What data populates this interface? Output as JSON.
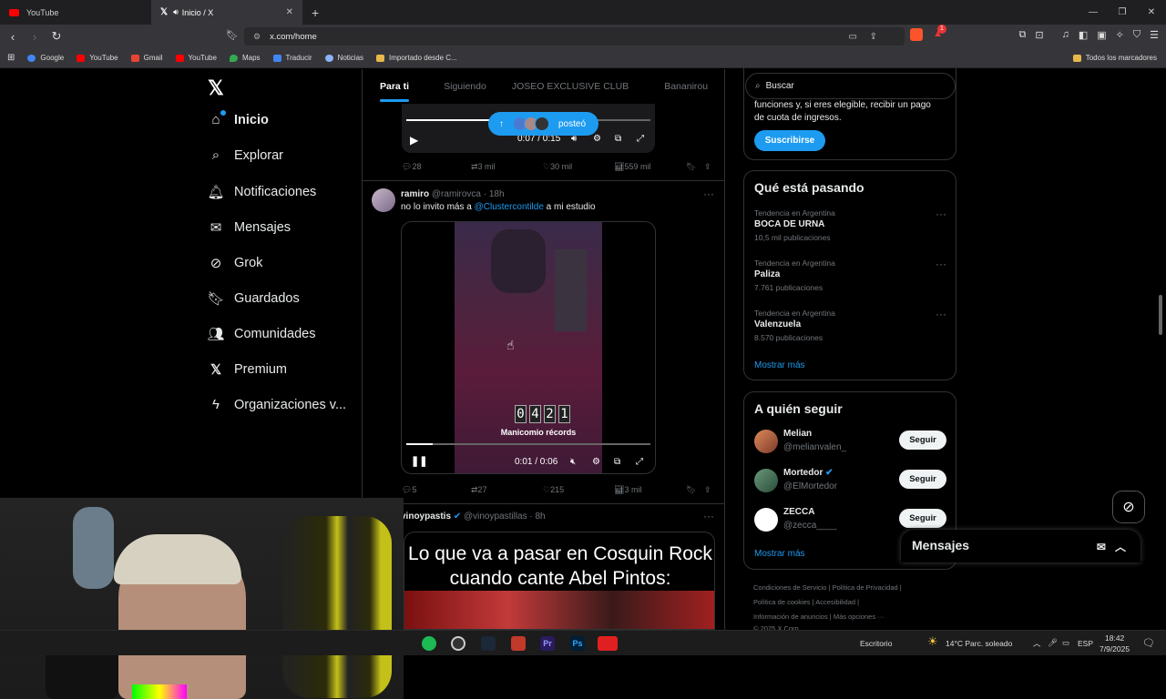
{
  "browser": {
    "tabs": [
      {
        "label": "YouTube",
        "active": false
      },
      {
        "label": "Inicio / X",
        "active": true
      }
    ],
    "new_tab": "+",
    "url": "x.com/home",
    "brave_badge": "1",
    "bookmarks": [
      "Google",
      "YouTube",
      "Gmail",
      "YouTube",
      "Maps",
      "Traducir",
      "Noticias",
      "Importado desde C..."
    ],
    "all_bookmarks": "Todos los marcadores"
  },
  "left_nav": {
    "items": [
      {
        "label": "Inicio",
        "icon": "home-icon"
      },
      {
        "label": "Explorar",
        "icon": "search-icon"
      },
      {
        "label": "Notificaciones",
        "icon": "bell-icon"
      },
      {
        "label": "Mensajes",
        "icon": "envelope-icon"
      },
      {
        "label": "Grok",
        "icon": "grok-icon"
      },
      {
        "label": "Guardados",
        "icon": "bookmark-icon"
      },
      {
        "label": "Comunidades",
        "icon": "people-icon"
      },
      {
        "label": "Premium",
        "icon": "x-icon"
      },
      {
        "label": "Organizaciones v...",
        "icon": "lightning-icon"
      }
    ]
  },
  "feed": {
    "tabs": [
      "Para ti",
      "Siguiendo",
      "JOSEO EXCLUSIVE CLUB",
      "Bananirou"
    ],
    "posteo_label": "posteó",
    "post1": {
      "time": "0:07 / 0:15",
      "progress": 0.47,
      "replies": "28",
      "reposts": "3 mil",
      "likes": "30 mil",
      "views": "559 mil"
    },
    "post2": {
      "name": "ramiro",
      "handle": "@ramirovca",
      "age": "· 18h",
      "text_before": "no lo invito más a ",
      "mention": "@Clustercontilde",
      "text_after": " a mi estudio",
      "counter_digits": [
        "0",
        "4",
        "2",
        "1"
      ],
      "video_caption": "Manicomio récords",
      "time": "0:01 / 0:06",
      "progress": 0.11,
      "replies": "5",
      "reposts": "27",
      "likes": "215",
      "views": "3 mil"
    },
    "post3": {
      "name": "vinoypastis",
      "handle": "@vinoypastillas",
      "age": "· 8h",
      "meme_line1": "Lo que va a pasar en Cosquin Rock",
      "meme_line2": "cuando cante Abel Pintos:"
    }
  },
  "right": {
    "search_placeholder": "Buscar",
    "premium_text1": "funciones y, si eres elegible, recibir un pago",
    "premium_text2": "de cuota de ingresos.",
    "subscribe": "Suscribirse",
    "trends_title": "Qué está pasando",
    "trends": [
      {
        "context": "Tendencia en Argentina",
        "name": "BOCA DE URNA",
        "count": "10,5 mil publicaciones"
      },
      {
        "context": "Tendencia en Argentina",
        "name": "Paliza",
        "count": "7.761 publicaciones"
      },
      {
        "context": "Tendencia en Argentina",
        "name": "Valenzuela",
        "count": "8.570 publicaciones"
      }
    ],
    "show_more": "Mostrar más",
    "follow_title": "A quién seguir",
    "follow": [
      {
        "name": "Melian",
        "handle": "@melianvalen_",
        "verified": false
      },
      {
        "name": "Mortedor",
        "handle": "@ElMortedor",
        "verified": true
      },
      {
        "name": "ZECCA",
        "handle": "@zecca____",
        "verified": false
      }
    ],
    "follow_btn": "Seguir",
    "footer1": "Condiciones de Servicio  |  Política de Privacidad  |",
    "footer2": "Política de cookies  |  Accesibilidad  |",
    "footer3": "Información de anuncios  |  Más opciones ···",
    "footer4": "© 2025 X Corp.",
    "messages": "Mensajes"
  },
  "taskbar": {
    "desktop": "Escritorio",
    "weather": "14°C  Parc. soleado",
    "lang": "ESP",
    "time": "18:42",
    "date": "7/9/2025"
  },
  "colors": {
    "accent": "#1d9bf0",
    "bg": "#000000",
    "border": "#2f3336",
    "muted": "#71767b"
  }
}
